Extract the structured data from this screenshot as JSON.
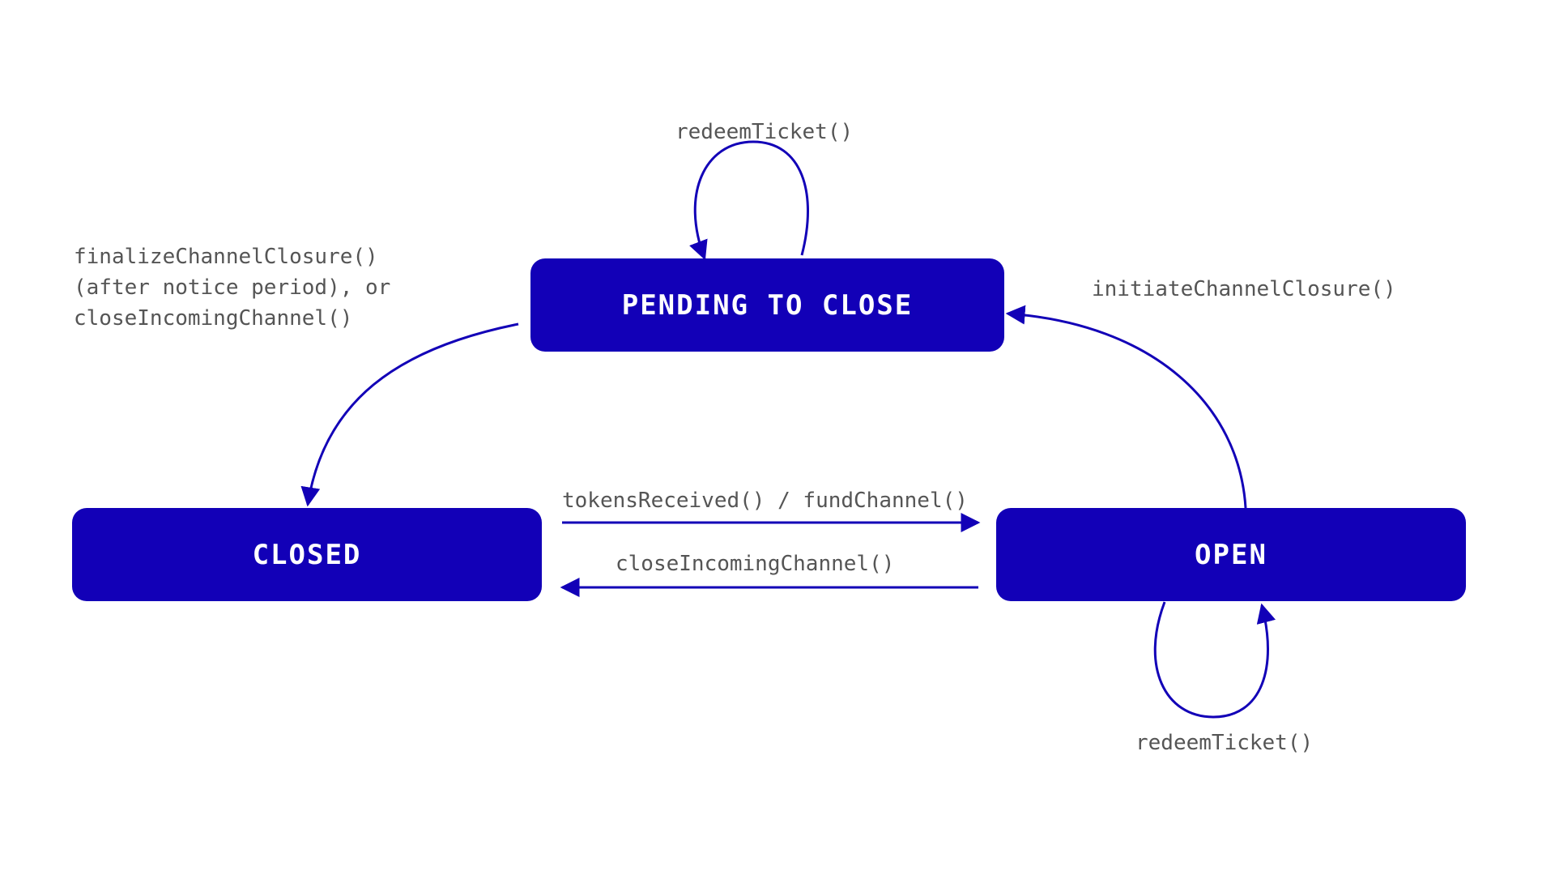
{
  "colors": {
    "accent": "#1200b7",
    "label": "#555555"
  },
  "states": {
    "pending": "PENDING TO CLOSE",
    "closed": "CLOSED",
    "open": "OPEN"
  },
  "transitions": {
    "redeem_pending": "redeemTicket()",
    "initiate": "initiateChannelClosure()",
    "finalize_line1": "finalizeChannelClosure()",
    "finalize_line2": "(after notice period), or",
    "finalize_line3": "closeIncomingChannel()",
    "fund": "tokensReceived() / fundChannel()",
    "close_incoming": "closeIncomingChannel()",
    "redeem_open": "redeemTicket()"
  }
}
